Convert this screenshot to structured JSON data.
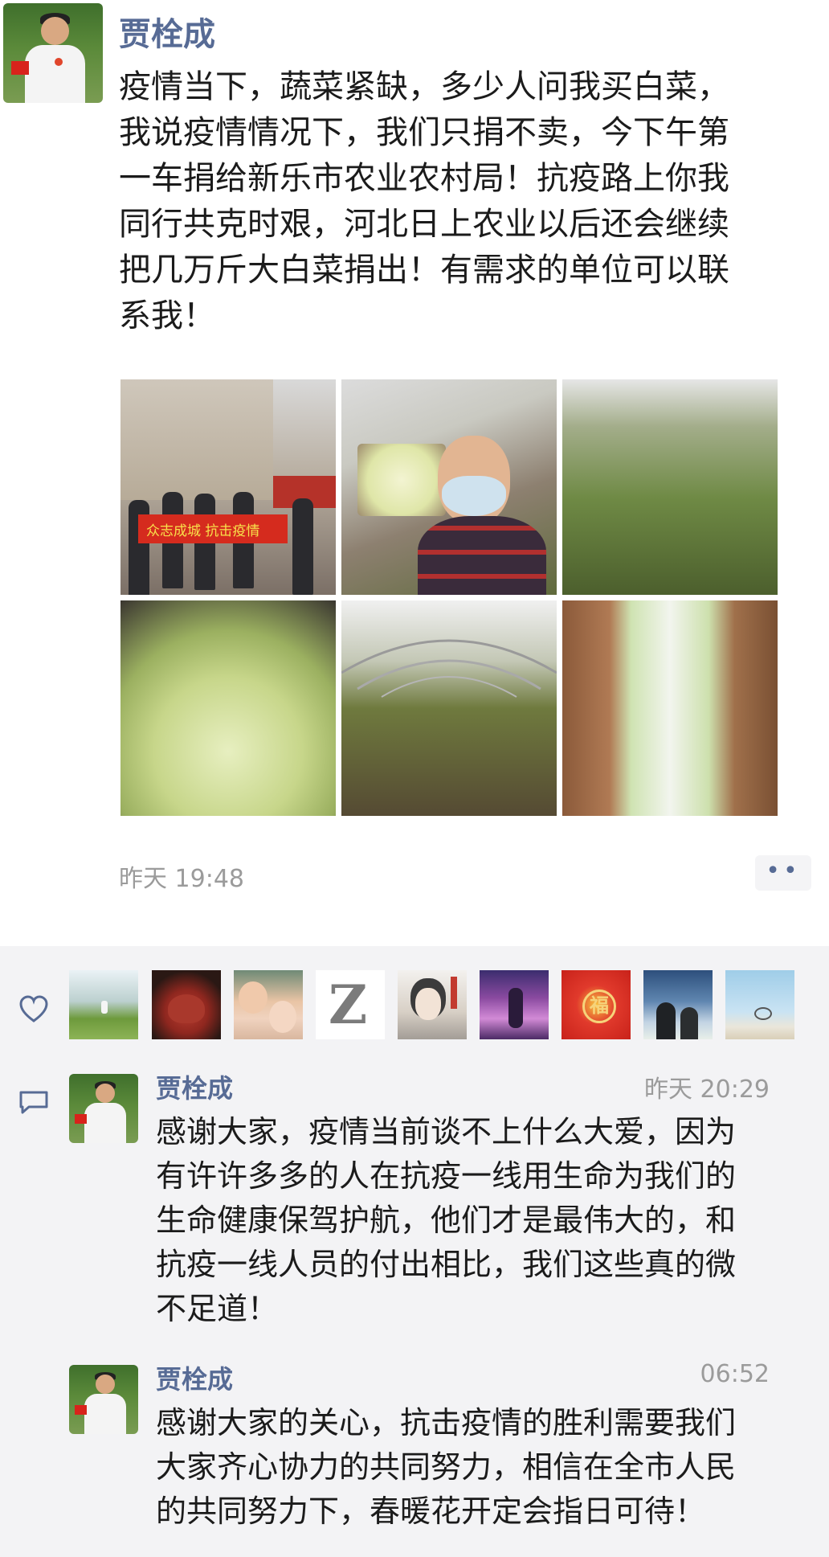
{
  "post": {
    "author": "贾栓成",
    "text_lines": [
      "疫情当下，蔬菜紧缺，多少人问我买白菜，",
      "我说疫情情况下，我们只捐不卖，今下午第",
      "一车捐给新乐市农业农村局！抗疫路上你我",
      "同行共克时艰，河北日上农业以后还会继续",
      "把几万斤大白菜捐出！有需求的单位可以联",
      "系我！"
    ],
    "banner_text": "众志成城  抗击疫情",
    "timestamp": "昨天 19:48",
    "more_label": "••",
    "photos": [
      "photo-donation-team",
      "photo-selfie-van",
      "photo-greenhouse-field",
      "photo-cabbage-load",
      "photo-greenhouse-rows",
      "photo-cabbage-closeup"
    ]
  },
  "likes": {
    "icon": "heart-icon",
    "avatars": [
      "avatar-field",
      "avatar-teapot",
      "avatar-child",
      "avatar-letter-z",
      "avatar-drawing",
      "avatar-stage",
      "avatar-fu",
      "avatar-beach",
      "avatar-cyclist"
    ],
    "fu_char": "福",
    "z_char": "Z"
  },
  "comments": [
    {
      "author": "贾栓成",
      "time": "昨天 20:29",
      "text": "感谢大家，疫情当前谈不上什么大爱，因为\n有许许多多的人在抗疫一线用生命为我们的\n生命健康保驾护航，他们才是最伟大的，和\n抗疫一线人员的付出相比，我们这些真的微\n不足道！"
    },
    {
      "author": "贾栓成",
      "time": "06:52",
      "text": "感谢大家的关心，抗击疫情的胜利需要我们\n大家齐心协力的共同努力，相信在全市人民\n的共同努力下，春暖花开定会指日可待！"
    }
  ]
}
